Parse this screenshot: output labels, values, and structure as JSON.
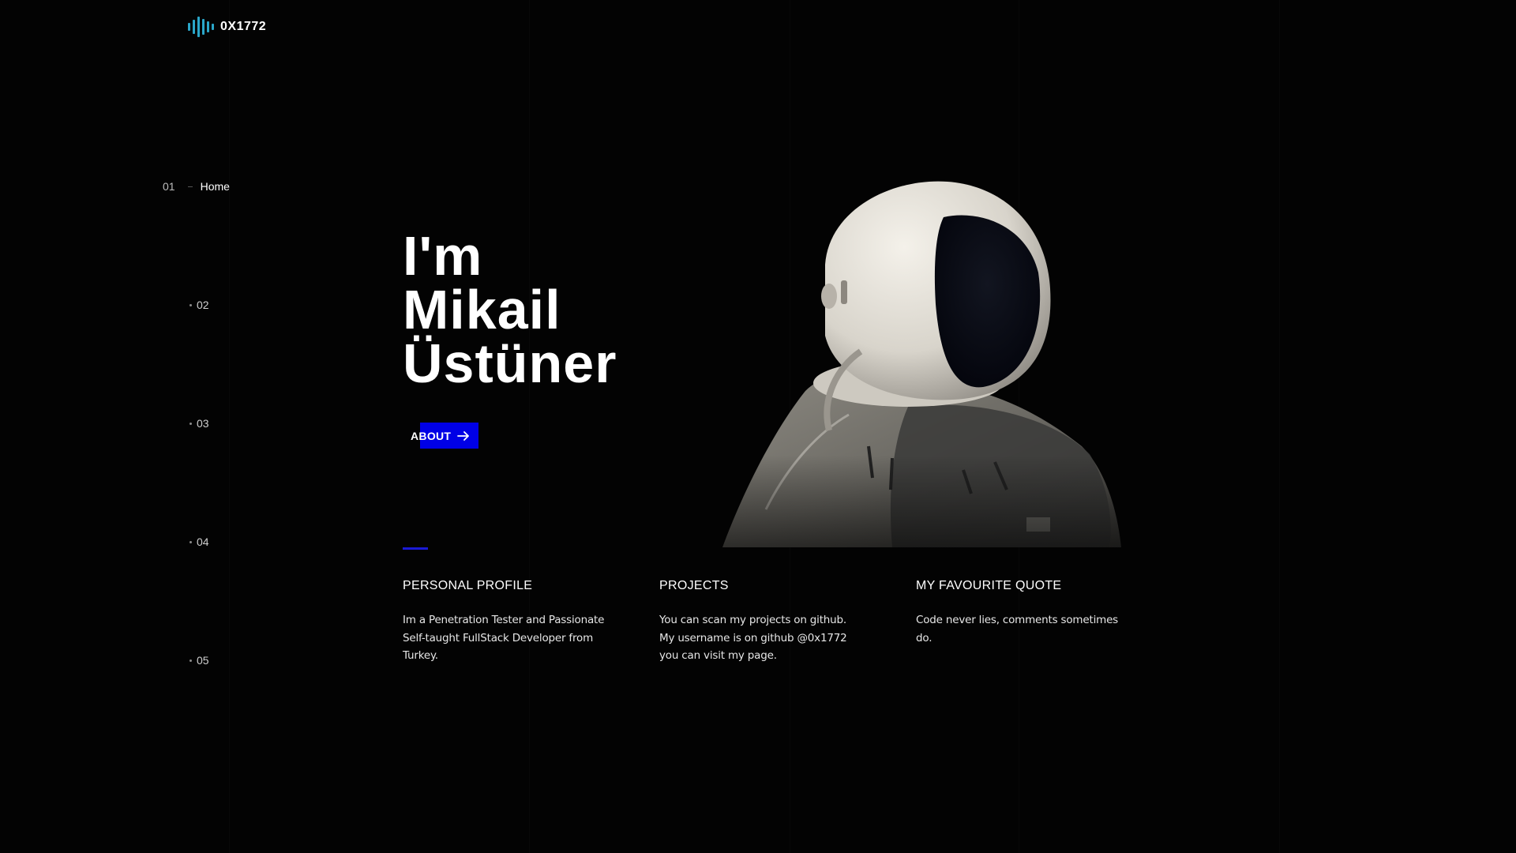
{
  "brand": {
    "logo_text": "0X1772",
    "logo_icon": "sound-wave-icon",
    "accent_color": "#2aa6c9"
  },
  "side_nav": {
    "items": [
      {
        "number": "01",
        "label": "Home"
      },
      {
        "number": "02"
      },
      {
        "number": "03"
      },
      {
        "number": "04"
      },
      {
        "number": "05"
      }
    ]
  },
  "hero": {
    "title_line1": "I'm",
    "title_line2": "Mikail",
    "title_line3": "Üstüner",
    "cta_label": "ABOUT",
    "cta_icon": "arrow-right-icon",
    "cta_color": "#0000e6",
    "image": "astronaut-illustration"
  },
  "sections": [
    {
      "heading": "PERSONAL PROFILE",
      "body": "Im a Penetration Tester and Passionate Self-taught FullStack Developer from Turkey."
    },
    {
      "heading": "PROJECTS",
      "body": "You can scan my projects on github. My username is on github @0x1772 you can visit my page."
    },
    {
      "heading": "MY FAVOURITE QUOTE",
      "body": "Code never lies, comments sometimes do."
    }
  ]
}
